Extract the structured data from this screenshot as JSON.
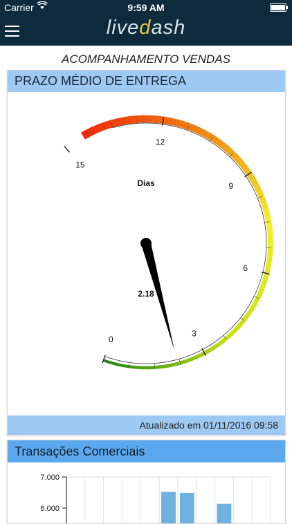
{
  "status": {
    "carrier": "Carrier",
    "time": "9:59 AM"
  },
  "nav": {
    "logo_pre": "live",
    "logo_accent": "d",
    "logo_post": "ash"
  },
  "page": {
    "title": "ACOMPANHAMENTO VENDAS"
  },
  "gauge_card": {
    "title": "PRAZO MÉDIO DE ENTREGA",
    "label": "Dias",
    "value_text": "2.18",
    "updated": "Atualizado em 01/11/2016 09:58",
    "chart_data": {
      "type": "gauge",
      "min": 0,
      "max": 15,
      "value": 2.18,
      "major_ticks": [
        0,
        3,
        6,
        9,
        12,
        15
      ],
      "color_stops": [
        "#1e8a10",
        "#c8e012",
        "#f4ee2a",
        "#f07a10",
        "#ee1c0c"
      ]
    }
  },
  "bar_card": {
    "title": "Transações Comerciais",
    "chart_data": {
      "type": "bar",
      "yticks": [
        "7.000",
        "6.000"
      ],
      "ylim": [
        5800,
        7000
      ],
      "values": [
        null,
        null,
        null,
        null,
        null,
        6520,
        6490,
        null,
        6140,
        null,
        null
      ]
    }
  }
}
